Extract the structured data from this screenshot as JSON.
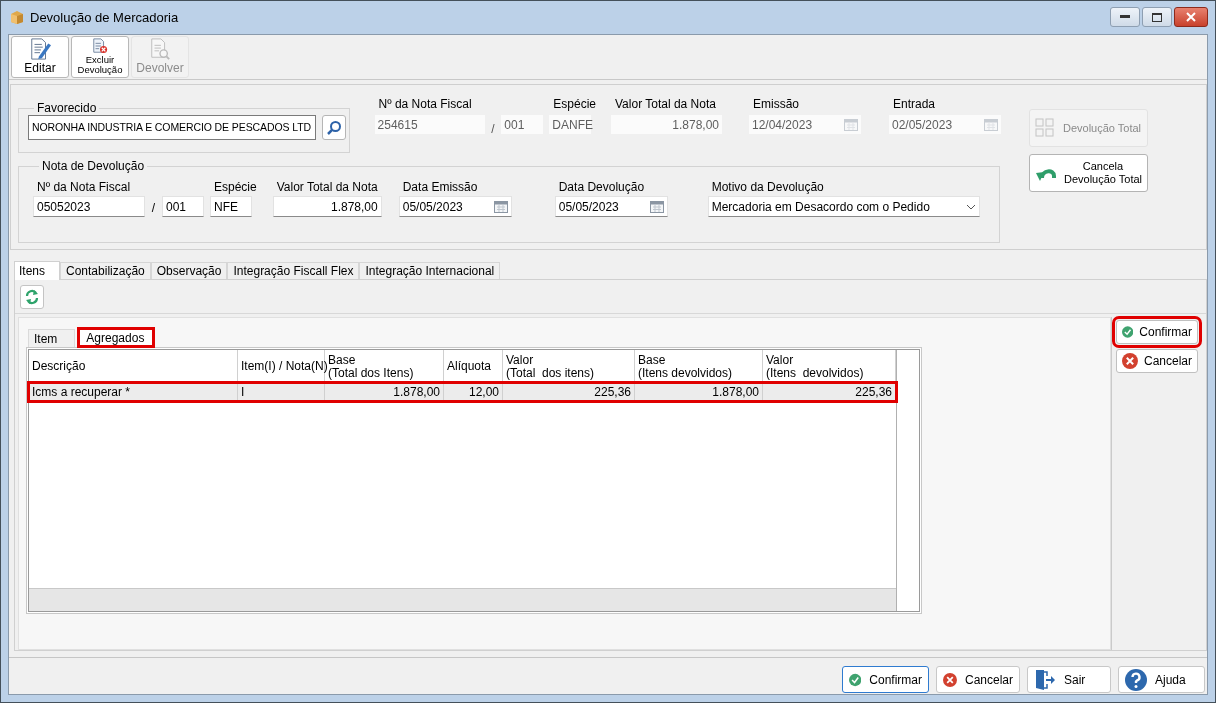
{
  "window": {
    "title": "Devolução de Mercadoria"
  },
  "toolbar": [
    {
      "label": "Editar",
      "kind": "edit",
      "disabled": false
    },
    {
      "label": "Excluir Devolução",
      "kind": "delete",
      "disabled": false
    },
    {
      "label": "Devolver",
      "kind": "return",
      "disabled": true
    }
  ],
  "source_note": {
    "readonly": true,
    "favorecido": {
      "label": "Favorecido",
      "value": "NORONHA INDUSTRIA E COMERCIO DE PESCADOS LTD"
    },
    "nota_fiscal": {
      "label": "Nº da Nota Fiscal",
      "number": "254615",
      "separator": "/",
      "series": "001"
    },
    "especie": {
      "label": "Espécie",
      "value": "DANFE"
    },
    "valor_total": {
      "label": "Valor Total da Nota",
      "value": "1.878,00"
    },
    "emissao": {
      "label": "Emissão",
      "value": "12/04/2023"
    },
    "entrada": {
      "label": "Entrada",
      "value": "02/05/2023"
    }
  },
  "side_actions": [
    {
      "label": "Devolução Total",
      "kind": "grid",
      "disabled": true
    },
    {
      "label": "Cancela\nDevolução Total",
      "kind": "undo",
      "disabled": false
    }
  ],
  "return_note": {
    "title": "Nota de Devolução",
    "nota_fiscal": {
      "label": "Nº da Nota Fiscal",
      "number": "05052023",
      "separator": "/",
      "series": "001"
    },
    "especie": {
      "label": "Espécie",
      "value": "NFE"
    },
    "valor_total": {
      "label": "Valor Total da Nota",
      "value": "1.878,00"
    },
    "data_emissao": {
      "label": "Data Emissão",
      "value": "05/05/2023"
    },
    "data_devolucao": {
      "label": "Data Devolução",
      "value": "05/05/2023"
    },
    "motivo": {
      "label": "Motivo da Devolução",
      "value": "Mercadoria em Desacordo com o Pedido"
    }
  },
  "tabs": [
    {
      "label": "Itens",
      "selected": true
    },
    {
      "label": "Contabilização",
      "selected": false
    },
    {
      "label": "Observação",
      "selected": false
    },
    {
      "label": "Integração Fiscall Flex",
      "selected": false
    },
    {
      "label": "Integração Internacional",
      "selected": false
    }
  ],
  "subtabs": [
    {
      "label": "Item",
      "selected": false,
      "highlighted": false
    },
    {
      "label": "Agregados",
      "selected": true,
      "highlighted": true
    }
  ],
  "table": {
    "columns": [
      {
        "label": "Descrição",
        "kind": "text"
      },
      {
        "label": "Item(I) / Nota(N)",
        "kind": "text"
      },
      {
        "label": "Base\n(Total dos Itens)",
        "kind": "number"
      },
      {
        "label": "Alíquota",
        "kind": "number"
      },
      {
        "label": "Valor\n(Total  dos itens)",
        "kind": "number"
      },
      {
        "label": "Base\n(Itens devolvidos)",
        "kind": "number"
      },
      {
        "label": "Valor\n(Itens  devolvidos)",
        "kind": "number"
      }
    ],
    "rows": [
      {
        "selected": true,
        "highlighted": true,
        "cells": [
          "Icms a recuperar *",
          "I",
          "1.878,00",
          "12,00",
          "225,36",
          "1.878,00",
          "225,36"
        ]
      }
    ]
  },
  "item_actions": [
    {
      "label": "Confirmar",
      "kind": "confirm",
      "highlighted": true
    },
    {
      "label": "Cancelar",
      "kind": "cancel",
      "highlighted": false
    }
  ],
  "footer_buttons": [
    {
      "label": "Confirmar",
      "kind": "confirm",
      "focused": true
    },
    {
      "label": "Cancelar",
      "kind": "cancel",
      "focused": false
    },
    {
      "label": "Sair",
      "kind": "exit",
      "focused": false
    },
    {
      "label": "Ajuda",
      "kind": "help",
      "focused": false
    }
  ]
}
